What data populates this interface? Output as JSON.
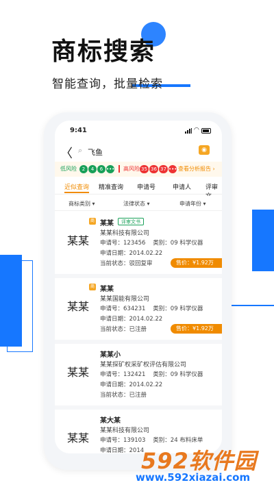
{
  "hero": {
    "title": "商标搜索",
    "subtitle": "智能查询，批量检索"
  },
  "status": {
    "time": "9:41"
  },
  "search": {
    "back": "〈",
    "query": "飞鱼",
    "search_icon": "search-icon",
    "camera_icon": "camera-icon"
  },
  "risk": {
    "low_label": "低风险",
    "low_counts": [
      "2",
      "4",
      "6"
    ],
    "high_label": "高风险",
    "high_counts": [
      "35",
      "36",
      "37"
    ],
    "link": "查看分析报告",
    "link_arrow": "›"
  },
  "tabs": [
    {
      "label": "近似查询",
      "active": true
    },
    {
      "label": "精准查询",
      "active": false
    },
    {
      "label": "申请号",
      "active": false
    },
    {
      "label": "申请人",
      "active": false
    },
    {
      "label": "评审文",
      "active": false
    }
  ],
  "filters": [
    {
      "label": "商标类别",
      "arrow": "▾"
    },
    {
      "label": "法律状态",
      "arrow": "▾"
    },
    {
      "label": "申请年份",
      "arrow": "▾"
    }
  ],
  "results": [
    {
      "thumb": "某某",
      "name": "某某",
      "tag": "商",
      "badge": "评审文书",
      "company": "某某科技有限公司",
      "app_label": "申请号：",
      "app_no": "123456",
      "class_label": "类别：",
      "class": "09 科学仪器",
      "date_label": "申请日期：",
      "date": "2014.02.22",
      "state_label": "当前状态：",
      "state": "驳回复审",
      "price": "售价：¥1.92万"
    },
    {
      "thumb": "某某",
      "name": "某某",
      "tag": "商",
      "badge": "",
      "company": "某某国能有限公司",
      "app_label": "申请号：",
      "app_no": "634231",
      "class_label": "类别：",
      "class": "09 科学仪器",
      "date_label": "申请日期：",
      "date": "2014.02.22",
      "state_label": "当前状态：",
      "state": "已注册",
      "price": "售价：¥1.92万"
    },
    {
      "thumb": "某某",
      "name": "某某小",
      "tag": "",
      "badge": "",
      "company": "某某探矿权采矿权评估有限公司",
      "app_label": "申请号：",
      "app_no": "132421",
      "class_label": "类别：",
      "class": "09 科学仪器",
      "date_label": "申请日期：",
      "date": "2014.02.22",
      "state_label": "当前状态：",
      "state": "已注册",
      "price": ""
    },
    {
      "thumb": "某某",
      "name": "某大某",
      "tag": "",
      "badge": "",
      "company": "某某科技有限公司",
      "app_label": "申请号：",
      "app_no": "139103",
      "class_label": "类别：",
      "class": "24 布料床单",
      "date_label": "申请日期：",
      "date": "2014",
      "state_label": "",
      "state": "",
      "price": ""
    }
  ],
  "watermark": {
    "big": "592软件园",
    "small": "www.592xiazai.com"
  },
  "colors": {
    "accent": "#1677ff",
    "orange": "#f08b00",
    "green": "#18a058",
    "red": "#e33333"
  }
}
